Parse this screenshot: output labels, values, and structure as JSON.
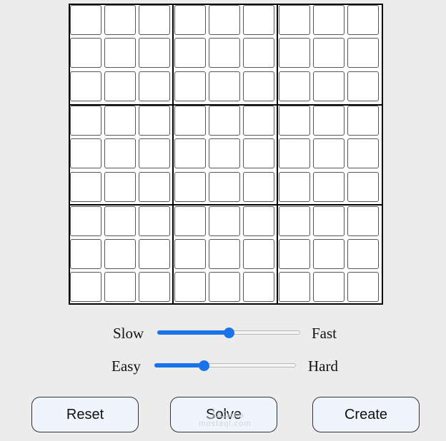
{
  "board": {
    "cells": [
      [
        "",
        "",
        "",
        "",
        "",
        "",
        "",
        "",
        ""
      ],
      [
        "",
        "",
        "",
        "",
        "",
        "",
        "",
        "",
        ""
      ],
      [
        "",
        "",
        "",
        "",
        "",
        "",
        "",
        "",
        ""
      ],
      [
        "",
        "",
        "",
        "",
        "",
        "",
        "",
        "",
        ""
      ],
      [
        "",
        "",
        "",
        "",
        "",
        "",
        "",
        "",
        ""
      ],
      [
        "",
        "",
        "",
        "",
        "",
        "",
        "",
        "",
        ""
      ],
      [
        "",
        "",
        "",
        "",
        "",
        "",
        "",
        "",
        ""
      ],
      [
        "",
        "",
        "",
        "",
        "",
        "",
        "",
        "",
        ""
      ],
      [
        "",
        "",
        "",
        "",
        "",
        "",
        "",
        "",
        ""
      ]
    ]
  },
  "speed": {
    "min_label": "Slow",
    "max_label": "Fast",
    "value": 0.5
  },
  "difficulty": {
    "min_label": "Easy",
    "max_label": "Hard",
    "value": 0.35
  },
  "buttons": {
    "reset": "Reset",
    "solve": "Solve",
    "create": "Create"
  },
  "watermark": {
    "logo": "مستقل",
    "text": "mostaql.com"
  },
  "colors": {
    "accent": "#1a73e8",
    "button_bg": "#eef5fc",
    "page_bg": "#ececec"
  }
}
